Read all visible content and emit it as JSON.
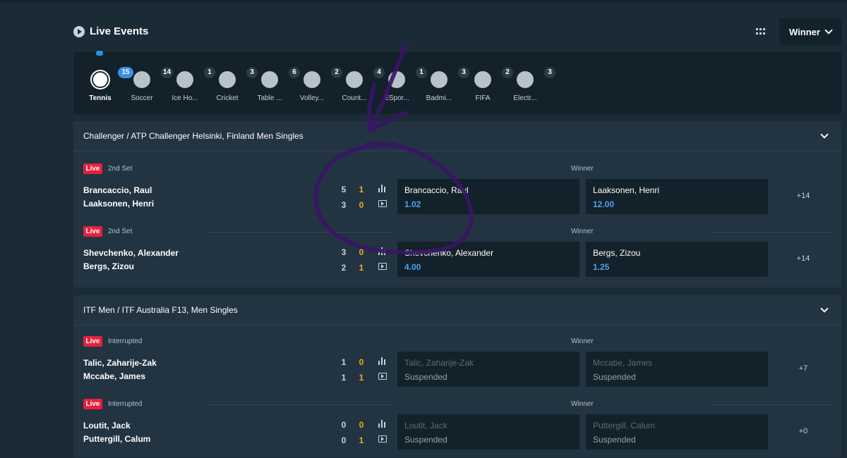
{
  "header": {
    "title": "Live Events",
    "market_select": "Winner"
  },
  "sports": [
    {
      "label": "Tennis",
      "count": "15",
      "active": true,
      "icon": "tennis-ball-icon"
    },
    {
      "label": "Soccer",
      "count": "14",
      "icon": "soccer-ball-icon"
    },
    {
      "label": "Ice Ho...",
      "count": "1",
      "icon": "ice-hockey-icon"
    },
    {
      "label": "Cricket",
      "count": "3",
      "icon": "cricket-ball-icon"
    },
    {
      "label": "Table ...",
      "count": "6",
      "icon": "table-tennis-icon"
    },
    {
      "label": "Volley...",
      "count": "2",
      "icon": "volleyball-icon"
    },
    {
      "label": "Count...",
      "count": "4",
      "icon": "counter-strike-icon"
    },
    {
      "label": "ESpor...",
      "count": "1",
      "icon": "esports-icon"
    },
    {
      "label": "Badmi...",
      "count": "3",
      "icon": "badminton-icon"
    },
    {
      "label": "FIFA",
      "count": "2",
      "icon": "fifa-icon"
    },
    {
      "label": "Electr...",
      "count": "3",
      "icon": "electronic-soccer-icon"
    }
  ],
  "tournaments": [
    {
      "name": "Challenger / ATP Challenger Helsinki, Finland Men Singles",
      "events": [
        {
          "live": "Live",
          "status": "2nd Set",
          "market": "Winner",
          "home": "Brancaccio, Raul",
          "away": "Laaksonen, Henri",
          "home_set": "5",
          "home_game": "1",
          "away_set": "3",
          "away_game": "0",
          "odd1_name": "Brancaccio, Raul",
          "odd1_value": "1.02",
          "odd2_name": "Laaksonen, Henri",
          "odd2_value": "12.00",
          "more": "+14"
        },
        {
          "live": "Live",
          "status": "2nd Set",
          "market": "Winner",
          "home": "Shevchenko, Alexander",
          "away": "Bergs, Zizou",
          "home_set": "3",
          "home_game": "0",
          "away_set": "2",
          "away_game": "1",
          "odd1_name": "Shevchenko, Alexander",
          "odd1_value": "4.00",
          "odd2_name": "Bergs, Zizou",
          "odd2_value": "1.25",
          "more": "+14"
        }
      ]
    },
    {
      "name": "ITF Men / ITF Australia F13, Men Singles",
      "events": [
        {
          "live": "Live",
          "status": "Interrupted",
          "market": "Winner",
          "home": "Talic, Zaharije-Zak",
          "away": "Mccabe, James",
          "home_set": "1",
          "home_game": "0",
          "away_set": "1",
          "away_game": "1",
          "odd1_name": "Talic, Zaharije-Zak",
          "odd1_value": "Suspended",
          "odd2_name": "Mccabe, James",
          "odd2_value": "Suspended",
          "more": "+7"
        },
        {
          "live": "Live",
          "status": "Interrupted",
          "market": "Winner",
          "home": "Loutit, Jack",
          "away": "Puttergill, Calum",
          "home_set": "0",
          "home_game": "0",
          "away_set": "0",
          "away_game": "1",
          "odd1_name": "Loutit, Jack",
          "odd1_value": "Suspended",
          "odd2_name": "Puttergill, Calum",
          "odd2_value": "Suspended",
          "more": "+0"
        }
      ]
    }
  ],
  "colors": {
    "live": "#e8203c",
    "odd": "#4ea1f2",
    "game_score": "#f4a724",
    "annotation": "#3a1466"
  }
}
